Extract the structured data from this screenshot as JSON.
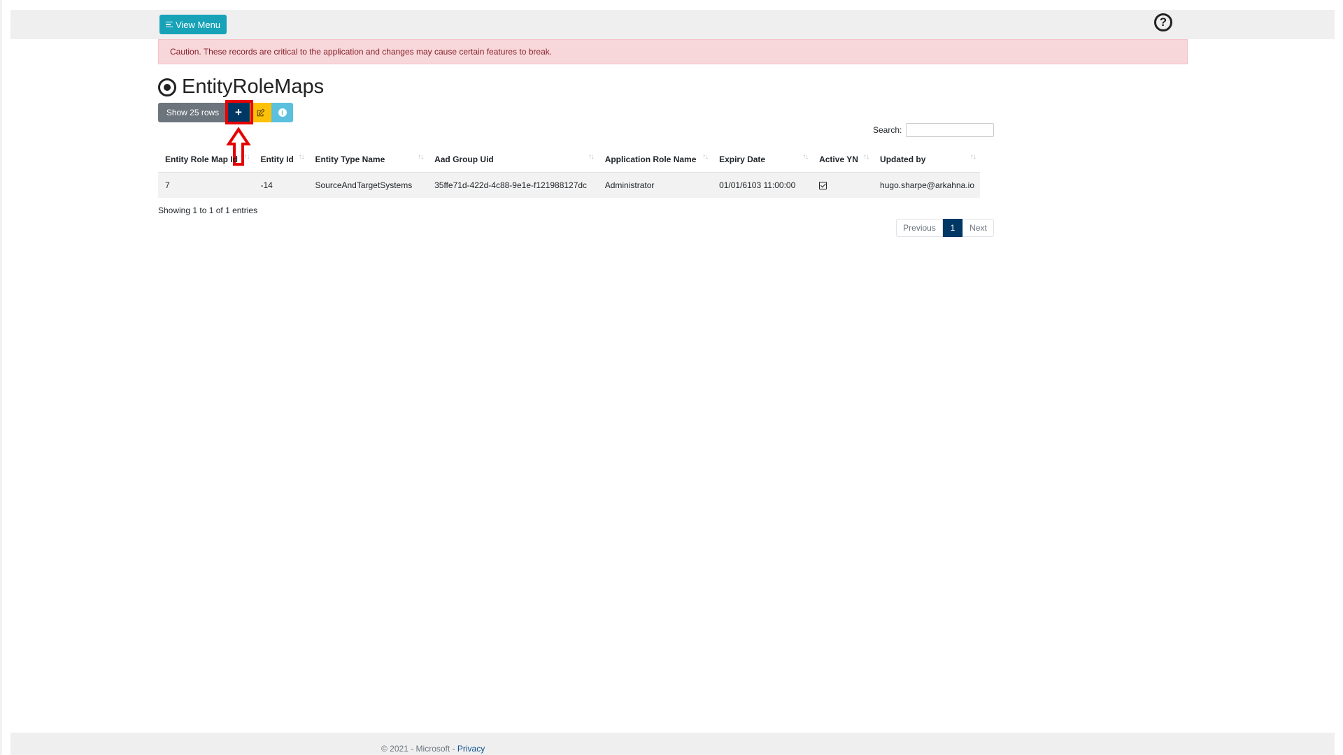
{
  "header": {
    "menu_button_label": "View Menu",
    "help_icon": "question-circle-icon"
  },
  "alert": {
    "text": "Caution. These records are critical to the application and changes may cause certain features to break."
  },
  "page": {
    "title": "EntityRoleMaps",
    "title_icon": "bullseye-icon"
  },
  "toolbar": {
    "show_rows_label": "Show 25 rows",
    "add_label": "+",
    "edit_icon": "edit-icon",
    "info_icon": "info-icon"
  },
  "search": {
    "label": "Search:",
    "value": ""
  },
  "table": {
    "columns": [
      "Entity Role Map Id",
      "Entity Id",
      "Entity Type Name",
      "Aad Group Uid",
      "Application Role Name",
      "Expiry Date",
      "Active YN",
      "Updated by"
    ],
    "rows": [
      {
        "entity_role_map_id": "7",
        "entity_id": "-14",
        "entity_type_name": "SourceAndTargetSystems",
        "aad_group_uid": "35ffe71d-422d-4c88-9e1e-f121988127dc",
        "application_role_name": "Administrator",
        "expiry_date": "01/01/6103 11:00:00",
        "active_yn": true,
        "updated_by": "hugo.sharpe@arkahna.io"
      }
    ]
  },
  "table_info": "Showing 1 to 1 of 1 entries",
  "pagination": {
    "previous": "Previous",
    "current": "1",
    "next": "Next"
  },
  "footer": {
    "copyright": "© 2021 - Microsoft - ",
    "privacy_link": "Privacy"
  },
  "colors": {
    "menu_button": "#17a2b8",
    "primary": "#003865",
    "alert_bg": "#f8d7da",
    "highlight": "#e60000"
  }
}
